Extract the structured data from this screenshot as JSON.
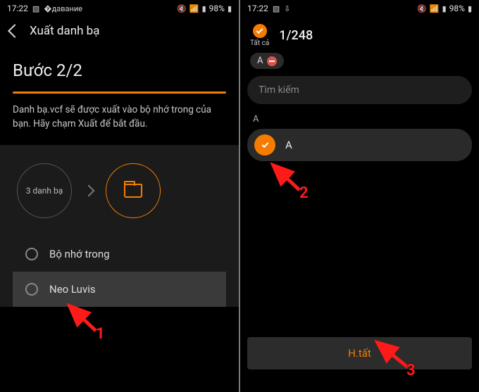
{
  "statusbar": {
    "time": "17:22",
    "battery": "98%"
  },
  "left": {
    "header_title": "Xuất danh bạ",
    "step_label": "Bước 2/2",
    "description": "Danh bạ.vcf sẽ được xuất vào bộ nhớ trong của bạn. Hãy chạm Xuất để bắt đầu.",
    "source_circle": "3 danh bạ",
    "options": {
      "internal_storage": "Bộ nhớ trong",
      "neo_luvis": "Neo Luvis"
    }
  },
  "right": {
    "select_all_label": "Tất cả",
    "count": "1/248",
    "chip_label": "A",
    "search_placeholder": "Tìm kiếm",
    "section": "A",
    "contact_name": "A",
    "done_label": "H.tất"
  },
  "annotations": {
    "n1": "1",
    "n2": "2",
    "n3": "3"
  }
}
